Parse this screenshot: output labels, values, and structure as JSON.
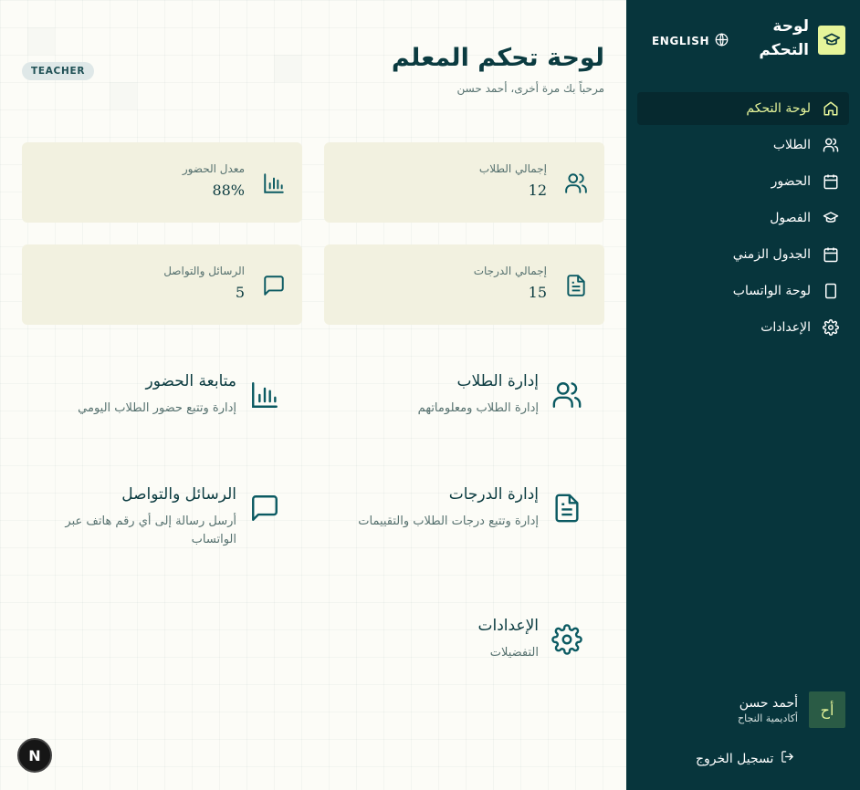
{
  "sidebar": {
    "brand_title": "لوحة التحكم",
    "lang_label": "ENGLISH",
    "items": [
      {
        "label": "لوحة التحكم",
        "icon": "home-icon",
        "active": true
      },
      {
        "label": "الطلاب",
        "icon": "users-icon",
        "active": false
      },
      {
        "label": "الحضور",
        "icon": "calendar-icon",
        "active": false
      },
      {
        "label": "الفصول",
        "icon": "graduation-cap-icon",
        "active": false
      },
      {
        "label": "الجدول الزمني",
        "icon": "calendar-icon",
        "active": false
      },
      {
        "label": "لوحة الواتساب",
        "icon": "tablet-icon",
        "active": false
      },
      {
        "label": "الإعدادات",
        "icon": "gear-icon",
        "active": false
      }
    ],
    "user": {
      "initials": "أح",
      "name": "أحمد حسن",
      "school": "أكاديمية النجاح"
    },
    "logout_label": "تسجيل الخروج"
  },
  "header": {
    "title": "لوحة تحكم المعلم",
    "welcome": "مرحباً بك مرة أخرى، أحمد حسن",
    "role_badge": "TEACHER"
  },
  "stats": [
    {
      "label": "إجمالي الطلاب",
      "value": "12",
      "icon": "users-icon"
    },
    {
      "label": "معدل الحضور",
      "value": "88%",
      "icon": "bar-chart-icon"
    },
    {
      "label": "إجمالي الدرجات",
      "value": "15",
      "icon": "document-icon"
    },
    {
      "label": "الرسائل والتواصل",
      "value": "5",
      "icon": "message-icon"
    }
  ],
  "features": [
    {
      "title": "إدارة الطلاب",
      "desc": "إدارة الطلاب ومعلوماتهم",
      "icon": "users-icon"
    },
    {
      "title": "متابعة الحضور",
      "desc": "إدارة وتتبع حضور الطلاب اليومي",
      "icon": "bar-chart-icon"
    },
    {
      "title": "إدارة الدرجات",
      "desc": "إدارة وتتبع درجات الطلاب والتقييمات",
      "icon": "document-icon"
    },
    {
      "title": "الرسائل والتواصل",
      "desc": "أرسل رسالة إلى أي رقم هاتف عبر الواتساب",
      "icon": "message-icon"
    },
    {
      "title": "الإعدادات",
      "desc": "التفضيلات",
      "icon": "gear-icon"
    }
  ],
  "colors": {
    "sidebar_bg": "#07353c",
    "accent": "#e6f59a",
    "card_bg": "#f2f1e0",
    "text": "#0b3b40"
  },
  "next_badge": "N"
}
